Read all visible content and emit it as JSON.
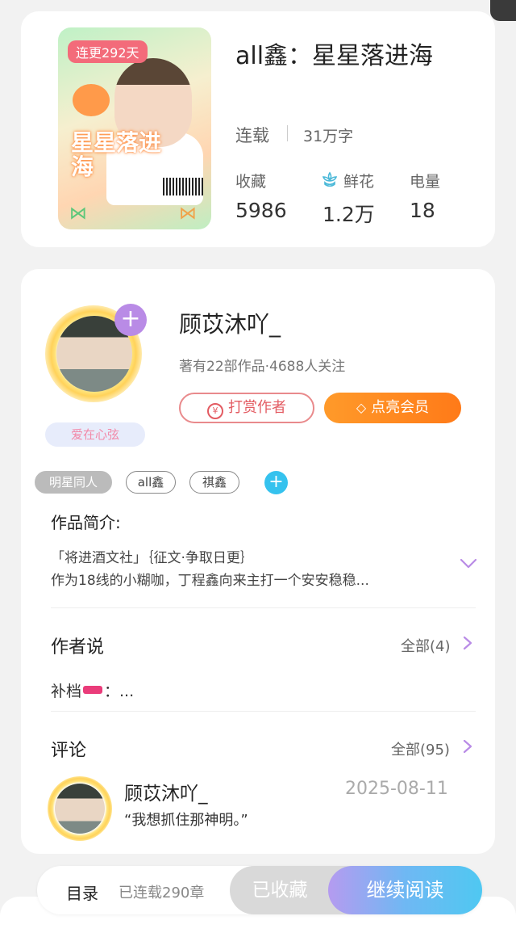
{
  "book": {
    "cover_badge": "连更292天",
    "cover_title": "星星落进海",
    "title": "all鑫：星星落进海",
    "status": "连载",
    "word_count": "31万字",
    "stats": [
      {
        "label": "收藏",
        "value": "5986"
      },
      {
        "label": "鲜花",
        "value": "1.2万",
        "icon": "flower-icon"
      },
      {
        "label": "电量",
        "value": "18"
      }
    ]
  },
  "author": {
    "name": "顾苡沐吖_",
    "meta": "著有22部作品·4688人关注",
    "badge": "爱在心弦",
    "tip_label": "打赏作者",
    "tip_icon_glyph": "¥",
    "vip_label": "点亮会员",
    "follow_glyph": "+"
  },
  "tags": [
    "明星同人",
    "all鑫",
    "祺鑫"
  ],
  "tag_add_glyph": "+",
  "intro": {
    "title": "作品简介:",
    "line1": "「将进酒文社」｛征文·争取日更｝",
    "line2": "作为18线的小糊咖，丁程鑫向来主打一个安安稳稳..."
  },
  "author_says": {
    "title": "作者说",
    "link": "全部(4)",
    "note_prefix": "补档",
    "note_suffix": "：..."
  },
  "comments": {
    "title": "评论",
    "link": "全部(95)",
    "items": [
      {
        "name": "顾苡沐吖_",
        "date": "2025-08-11",
        "text": "“我想抓住那神明。”"
      }
    ]
  },
  "bottom": {
    "toc_label": "目录",
    "toc_count": "已连载290章",
    "fav_label": "已收藏",
    "read_label": "继续阅读"
  },
  "colors": {
    "accent_purple": "#b98be6",
    "tip_red": "#e35b62",
    "vip_orange": "#ff8a1f",
    "tag_add_blue": "#35c2ee"
  }
}
